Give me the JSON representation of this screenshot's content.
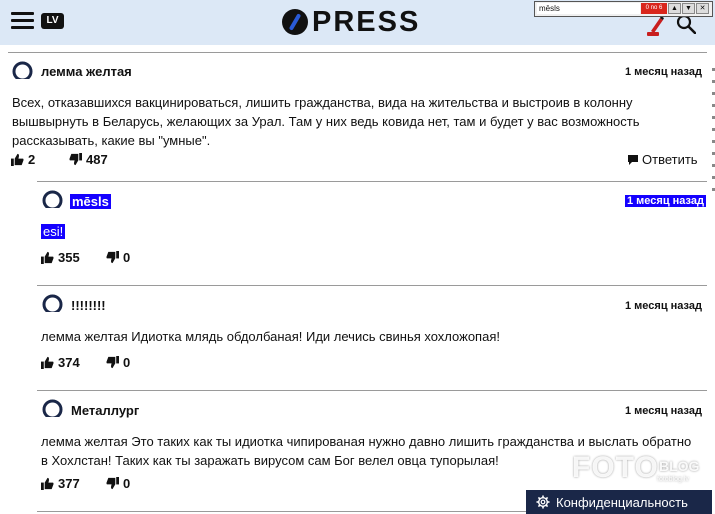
{
  "header": {
    "lang": "LV",
    "logo": "PRESS"
  },
  "findbar": {
    "query": "mēsls",
    "count": "0 no 6"
  },
  "comments": [
    {
      "author": "лемма желтая",
      "date": "1 месяц назад",
      "text": "Всех, отказавшихся вакцинироваться, лишить гражданства, вида на жительства и выстроив в колонну вышвырнуть в Беларусь, желающих за Урал. Там у них ведь ковида нет, там и будет у вас возможность рассказывать, какие вы \"умные\".",
      "likes": "2",
      "dislikes": "487",
      "reply": "Ответить"
    },
    {
      "author": "mēsls",
      "date": "1 месяц назад",
      "text": "esi!",
      "likes": "355",
      "dislikes": "0"
    },
    {
      "author": "!!!!!!!!",
      "date": "1 месяц назад",
      "text": "лемма желтая Идиотка млядь обдолбаная! Иди лечись свинья хохложопая!",
      "likes": "374",
      "dislikes": "0"
    },
    {
      "author": "Металлург",
      "date": "1 месяц назад",
      "text": "лемма желтая Это таких как ты идиотка чипированая нужно давно лишить гражданства и выслать обратно в Хохлстан! Таких как ты заражать вирусом сам Бог велел овца тупорылая!",
      "likes": "377",
      "dislikes": "0"
    }
  ],
  "watermark": {
    "foto": "FOTO",
    "blog": "BLOG",
    "site": "fotoblog.lv"
  },
  "privacy_label": "Конфиденциальность"
}
